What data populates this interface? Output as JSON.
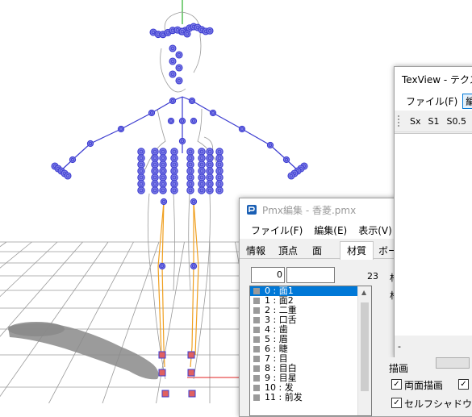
{
  "viewport": {
    "colors": {
      "bone": "#3b3bd0",
      "bone_fill": "#7f7fe6",
      "ik_chain": "#f0a020",
      "grid": "#9a9a9a",
      "shadow": "#8a8a8a",
      "axis_green": "#00a000",
      "axis_red": "#e02020"
    }
  },
  "pmx_window": {
    "title": "Pmx編集 - 香菱.pmx",
    "menu": [
      "ファイル(F)",
      "編集(E)",
      "表示(V)"
    ],
    "tabs": [
      "情報",
      "頂点",
      "面",
      "材質",
      "ボー"
    ],
    "active_tab": "材質",
    "index_field": "0",
    "name_field": "",
    "material_count": "23",
    "materials": [
      "0 : 面1",
      "1 : 面2",
      "2 : 二重",
      "3 : 口舌",
      "4 : 歯",
      "5 : 眉",
      "6 : 睫",
      "7 : 目",
      "8 : 目白",
      "9 : 目星",
      "10 : 发",
      "11 : 前发"
    ],
    "selected_index": 0,
    "side_labels": [
      "材",
      "材"
    ]
  },
  "texview_window": {
    "title": "TexView - テクスチ",
    "menu": [
      "ファイル(F)",
      "編"
    ],
    "toolbar": [
      "Sx",
      "S1",
      "S0.5",
      "S"
    ],
    "status": "-"
  },
  "drawing_section": {
    "header": "描画",
    "options": [
      {
        "label": "両面描画",
        "checked": true
      },
      {
        "label": "",
        "checked": true
      },
      {
        "label": "セルフシャドウ",
        "checked": true
      }
    ]
  }
}
